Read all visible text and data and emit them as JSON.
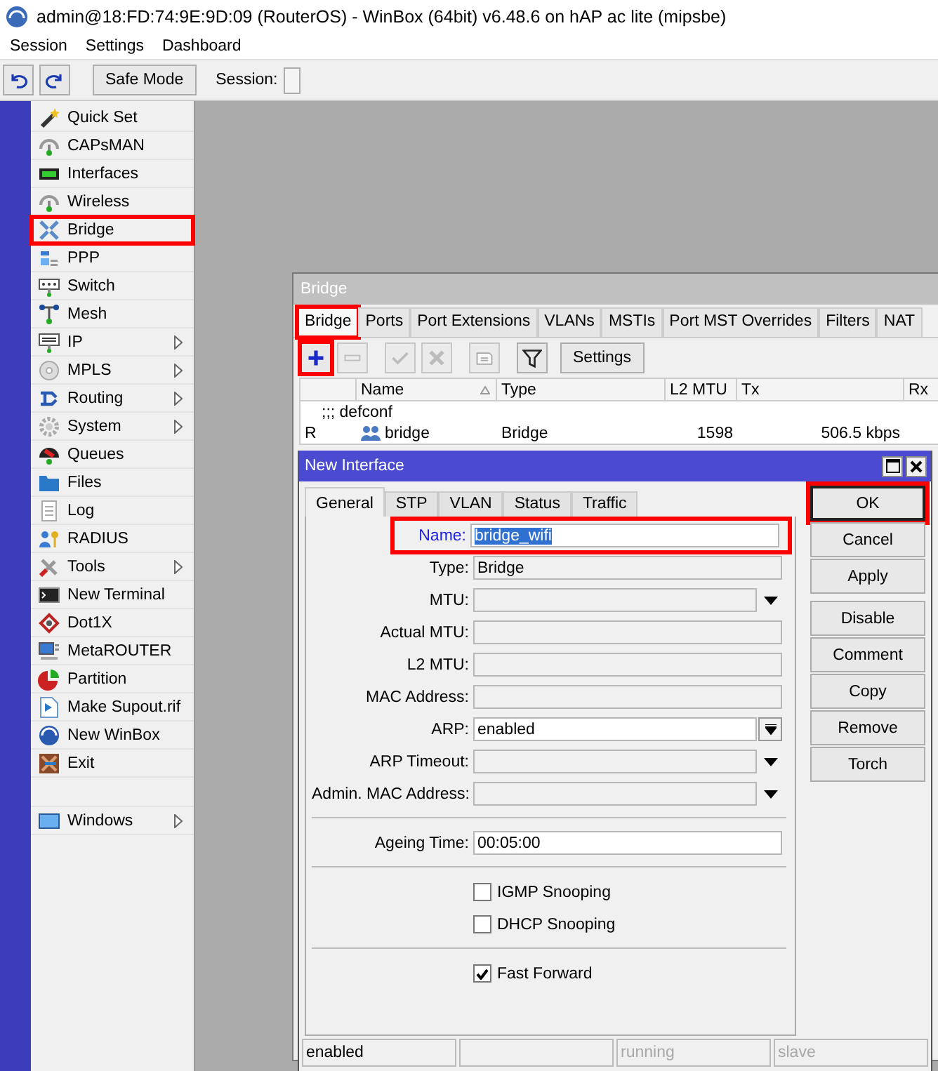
{
  "window": {
    "title": "admin@18:FD:74:9E:9D:09 (RouterOS) - WinBox (64bit) v6.48.6 on hAP ac lite (mipsbe)"
  },
  "menubar": [
    "Session",
    "Settings",
    "Dashboard"
  ],
  "toolbar": {
    "safe_mode": "Safe Mode",
    "session_label": "Session:"
  },
  "menu": {
    "items": [
      {
        "label": "Quick Set",
        "has_submenu": false,
        "highlighted": false
      },
      {
        "label": "CAPsMAN",
        "has_submenu": false,
        "highlighted": false
      },
      {
        "label": "Interfaces",
        "has_submenu": false,
        "highlighted": false
      },
      {
        "label": "Wireless",
        "has_submenu": false,
        "highlighted": false
      },
      {
        "label": "Bridge",
        "has_submenu": false,
        "highlighted": true
      },
      {
        "label": "PPP",
        "has_submenu": false,
        "highlighted": false
      },
      {
        "label": "Switch",
        "has_submenu": false,
        "highlighted": false
      },
      {
        "label": "Mesh",
        "has_submenu": false,
        "highlighted": false
      },
      {
        "label": "IP",
        "has_submenu": true,
        "highlighted": false
      },
      {
        "label": "MPLS",
        "has_submenu": true,
        "highlighted": false
      },
      {
        "label": "Routing",
        "has_submenu": true,
        "highlighted": false
      },
      {
        "label": "System",
        "has_submenu": true,
        "highlighted": false
      },
      {
        "label": "Queues",
        "has_submenu": false,
        "highlighted": false
      },
      {
        "label": "Files",
        "has_submenu": false,
        "highlighted": false
      },
      {
        "label": "Log",
        "has_submenu": false,
        "highlighted": false
      },
      {
        "label": "RADIUS",
        "has_submenu": false,
        "highlighted": false
      },
      {
        "label": "Tools",
        "has_submenu": true,
        "highlighted": false
      },
      {
        "label": "New Terminal",
        "has_submenu": false,
        "highlighted": false
      },
      {
        "label": "Dot1X",
        "has_submenu": false,
        "highlighted": false
      },
      {
        "label": "MetaROUTER",
        "has_submenu": false,
        "highlighted": false
      },
      {
        "label": "Partition",
        "has_submenu": false,
        "highlighted": false
      },
      {
        "label": "Make Supout.rif",
        "has_submenu": false,
        "highlighted": false
      },
      {
        "label": "New WinBox",
        "has_submenu": false,
        "highlighted": false
      },
      {
        "label": "Exit",
        "has_submenu": false,
        "highlighted": false
      }
    ],
    "bottom_items": [
      {
        "label": "Windows",
        "has_submenu": true,
        "highlighted": false
      }
    ]
  },
  "bridge_window": {
    "title": "Bridge",
    "tabs": [
      {
        "label": "Bridge",
        "selected": true,
        "highlighted": true
      },
      {
        "label": "Ports",
        "selected": false,
        "highlighted": false
      },
      {
        "label": "Port Extensions",
        "selected": false,
        "highlighted": false
      },
      {
        "label": "VLANs",
        "selected": false,
        "highlighted": false
      },
      {
        "label": "MSTIs",
        "selected": false,
        "highlighted": false
      },
      {
        "label": "Port MST Overrides",
        "selected": false,
        "highlighted": false
      },
      {
        "label": "Filters",
        "selected": false,
        "highlighted": false
      },
      {
        "label": "NAT",
        "selected": false,
        "highlighted": false
      }
    ],
    "tools": [
      {
        "kind": "add",
        "disabled": false,
        "highlighted": true
      },
      {
        "kind": "remove",
        "disabled": true,
        "highlighted": false
      },
      {
        "kind": "enable",
        "disabled": true,
        "highlighted": false
      },
      {
        "kind": "disable",
        "disabled": true,
        "highlighted": false
      },
      {
        "kind": "comment",
        "disabled": true,
        "highlighted": false
      },
      {
        "kind": "filter",
        "disabled": false,
        "highlighted": false
      },
      {
        "kind": "text",
        "label": "Settings",
        "disabled": false,
        "highlighted": false
      }
    ],
    "columns": [
      {
        "label": "Name",
        "sorted": true
      },
      {
        "label": "Type"
      },
      {
        "label": "L2 MTU"
      },
      {
        "label": "Tx"
      },
      {
        "label": "Rx"
      }
    ],
    "rows": [
      {
        "kind": "comment",
        "text": ";;; defconf"
      },
      {
        "kind": "item",
        "flag": "R",
        "name": "bridge",
        "type": "Bridge",
        "l2_mtu": "1598",
        "tx": "506.5 kbps"
      }
    ]
  },
  "dialog": {
    "title": "New Interface",
    "tabs": [
      {
        "label": "General",
        "selected": true
      },
      {
        "label": "STP",
        "selected": false
      },
      {
        "label": "VLAN",
        "selected": false
      },
      {
        "label": "Status",
        "selected": false
      },
      {
        "label": "Traffic",
        "selected": false
      }
    ],
    "field_groups": [
      [
        {
          "kind": "text",
          "label": "Name:",
          "value": "bridge_wifi",
          "focused": true,
          "highlighted": true
        },
        {
          "kind": "readonly",
          "label": "Type:",
          "value": "Bridge"
        },
        {
          "kind": "dropdown",
          "label": "MTU:"
        },
        {
          "kind": "readonly",
          "label": "Actual MTU:"
        },
        {
          "kind": "readonly",
          "label": "L2 MTU:"
        },
        {
          "kind": "readonly",
          "label": "MAC Address:"
        },
        {
          "kind": "combo",
          "label": "ARP:",
          "value": "enabled"
        },
        {
          "kind": "dropdown",
          "label": "ARP Timeout:"
        },
        {
          "kind": "dropdown",
          "label": "Admin. MAC Address:"
        }
      ],
      [
        {
          "kind": "text",
          "label": "Ageing Time:",
          "value": "00:05:00",
          "focused": false
        }
      ],
      [
        {
          "kind": "checkbox",
          "label": "IGMP Snooping",
          "checked": false
        },
        {
          "kind": "checkbox",
          "label": "DHCP Snooping",
          "checked": false
        }
      ],
      [
        {
          "kind": "checkbox",
          "label": "Fast Forward",
          "checked": true
        }
      ]
    ],
    "buttons": [
      [
        {
          "label": "OK",
          "default": true,
          "highlighted": true
        },
        {
          "label": "Cancel",
          "default": false,
          "highlighted": false
        },
        {
          "label": "Apply",
          "default": false,
          "highlighted": false
        }
      ],
      [
        {
          "label": "Disable",
          "default": false,
          "highlighted": false
        },
        {
          "label": "Comment",
          "default": false,
          "highlighted": false
        },
        {
          "label": "Copy",
          "default": false,
          "highlighted": false
        },
        {
          "label": "Remove",
          "default": false,
          "highlighted": false
        },
        {
          "label": "Torch",
          "default": false,
          "highlighted": false
        }
      ]
    ],
    "status_bar": [
      {
        "text": "enabled",
        "disabled": false
      },
      {
        "text": "running",
        "disabled": true
      },
      {
        "text": "slave",
        "disabled": true
      }
    ]
  }
}
